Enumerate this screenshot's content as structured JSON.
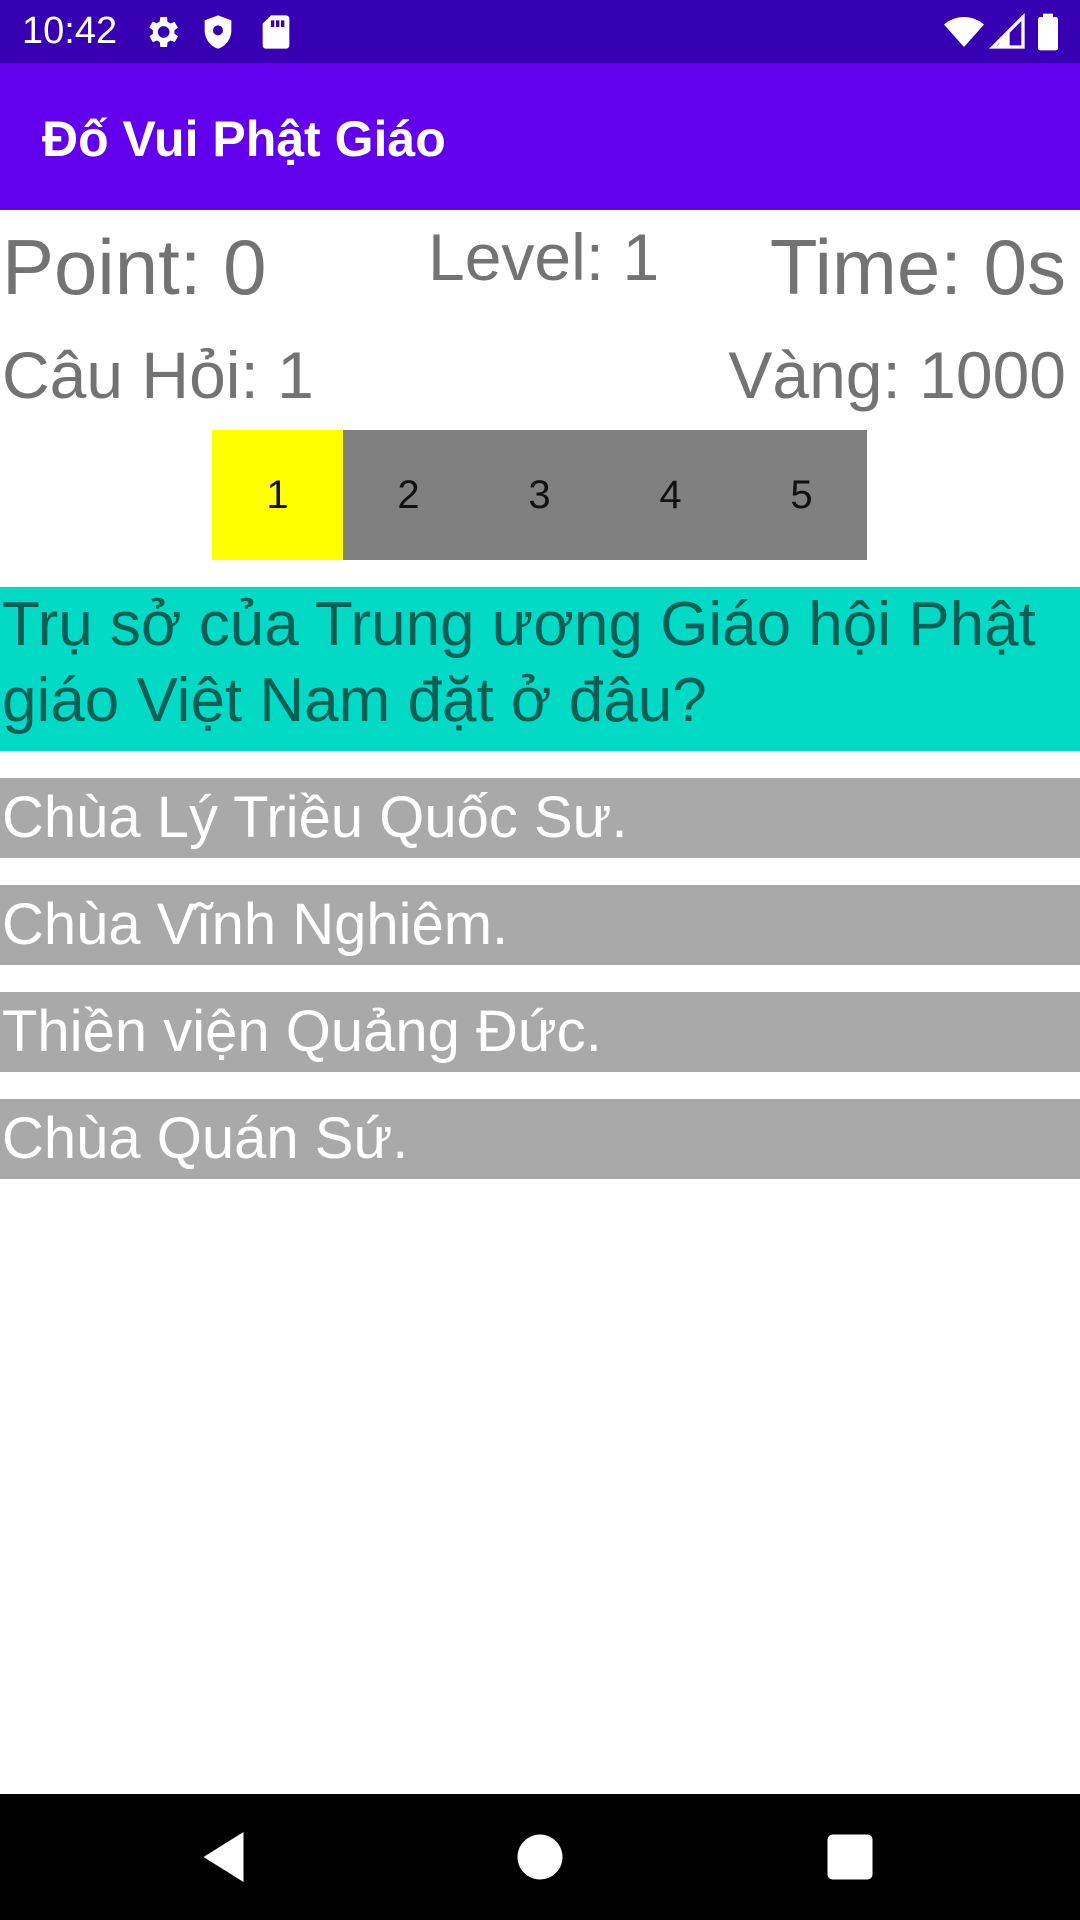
{
  "status_bar": {
    "time": "10:42",
    "icons_left": [
      "gear-icon",
      "shield-icon",
      "sd-card-icon"
    ],
    "icons_right": [
      "wifi-icon",
      "signal-icon",
      "battery-icon"
    ]
  },
  "app_bar": {
    "title": "Đố Vui Phật Giáo"
  },
  "stats": {
    "point": "Point: 0",
    "level": "Level: 1",
    "time": "Time: 0s",
    "question_no": "Câu Hỏi: 1",
    "gold": "Vàng: 1000"
  },
  "level_progress": {
    "cells": [
      "1",
      "2",
      "3",
      "4",
      "5"
    ],
    "active_index": 0,
    "active_color": "#FFFF00",
    "inactive_color": "#808080"
  },
  "question": {
    "text": "Trụ sở của Trung ương Giáo hội Phật giáo Việt Nam đặt ở đâu?",
    "background": "#03DAC5"
  },
  "answers": [
    "Chùa Lý Triều Quốc Sư.",
    "Chùa Vĩnh Nghiêm.",
    "Thiền viện Quảng Đức.",
    "Chùa Quán Sứ."
  ],
  "colors": {
    "status_bar": "#3700B3",
    "app_bar": "#6200EE",
    "answer_bg": "#A9A9A9"
  },
  "nav_bar": {
    "buttons": [
      "back-icon",
      "home-icon",
      "recents-icon"
    ]
  }
}
